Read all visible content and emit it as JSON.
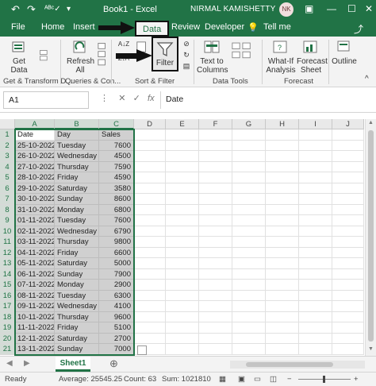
{
  "window": {
    "title": "Book1  -  Excel",
    "user_name": "NIRMAL KAMISHETTY",
    "user_initials": "NK"
  },
  "quick_access": {
    "undo_icon": "undo-icon",
    "redo_icon": "redo-icon",
    "spelling_icon": "spelling-check-icon",
    "more_icon": "customize-quick-access-icon"
  },
  "tabs": [
    "File",
    "Home",
    "Insert",
    "Data",
    "Review",
    "Developer",
    "Tell me"
  ],
  "active_tab": "Data",
  "ribbon": {
    "get_data": "Get\nData",
    "refresh_all": "Refresh\nAll",
    "filter": "Filter",
    "text_to_columns": "Text to\nColumns",
    "what_if": "What-If\nAnalysis",
    "forecast_sheet": "Forecast\nSheet",
    "outline": "Outline",
    "groups": {
      "get_transform": "Get & Transform D...",
      "queries": "Queries & Con...",
      "sort_filter": "Sort & Filter",
      "data_tools": "Data Tools",
      "forecast": "Forecast"
    }
  },
  "formula_bar": {
    "name_box": "A1",
    "formula": "Date"
  },
  "columns": [
    "A",
    "B",
    "C",
    "D",
    "E",
    "F",
    "G",
    "H",
    "I",
    "J"
  ],
  "table": {
    "headers": [
      "Date",
      "Day",
      "Sales"
    ],
    "rows": [
      [
        "25-10-2022",
        "Tuesday",
        "7600"
      ],
      [
        "26-10-2022",
        "Wednesday",
        "4500"
      ],
      [
        "27-10-2022",
        "Thursday",
        "7590"
      ],
      [
        "28-10-2022",
        "Friday",
        "4590"
      ],
      [
        "29-10-2022",
        "Saturday",
        "3580"
      ],
      [
        "30-10-2022",
        "Sunday",
        "8600"
      ],
      [
        "31-10-2022",
        "Monday",
        "6800"
      ],
      [
        "01-11-2022",
        "Tuesday",
        "7600"
      ],
      [
        "02-11-2022",
        "Wednesday",
        "6790"
      ],
      [
        "03-11-2022",
        "Thursday",
        "9800"
      ],
      [
        "04-11-2022",
        "Friday",
        "6600"
      ],
      [
        "05-11-2022",
        "Saturday",
        "5000"
      ],
      [
        "06-11-2022",
        "Sunday",
        "7900"
      ],
      [
        "07-11-2022",
        "Monday",
        "2900"
      ],
      [
        "08-11-2022",
        "Tuesday",
        "6300"
      ],
      [
        "09-11-2022",
        "Wednesday",
        "4100"
      ],
      [
        "10-11-2022",
        "Thursday",
        "9600"
      ],
      [
        "11-11-2022",
        "Friday",
        "5100"
      ],
      [
        "12-11-2022",
        "Saturday",
        "2700"
      ],
      [
        "13-11-2022",
        "Sunday",
        "7000"
      ]
    ]
  },
  "sheets": [
    "Sheet1"
  ],
  "status_bar": {
    "ready": "Ready",
    "average": "Average: 25545.25",
    "count": "Count: 63",
    "sum": "Sum: 1021810"
  },
  "colors": {
    "accent": "#217346",
    "selection_fill": "#d0d0d0"
  }
}
